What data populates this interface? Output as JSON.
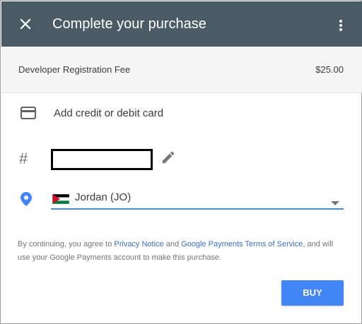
{
  "header": {
    "title": "Complete your purchase",
    "close_icon": "close-icon",
    "menu_icon": "more-vert-icon",
    "background_color": "#4a5b66"
  },
  "fee": {
    "label": "Developer Registration Fee",
    "amount": "$25.00"
  },
  "payment": {
    "add_card_label": "Add credit or debit card",
    "card_icon": "credit-card-icon"
  },
  "phone": {
    "hash_symbol": "#",
    "edit_icon": "pencil-icon"
  },
  "country": {
    "selected_value": "Jordan (JO)",
    "location_icon": "location-pin-icon",
    "accent_color": "#4285f4"
  },
  "notice": {
    "prefix": "By continuing, you agree to ",
    "privacy_link": "Privacy Notice",
    "and_text": " and ",
    "terms_link": "Google Payments Terms of Service",
    "suffix": ", and will use your Google Payments account to make this purchase."
  },
  "actions": {
    "buy_label": "BUY",
    "buy_color": "#4285f4"
  }
}
